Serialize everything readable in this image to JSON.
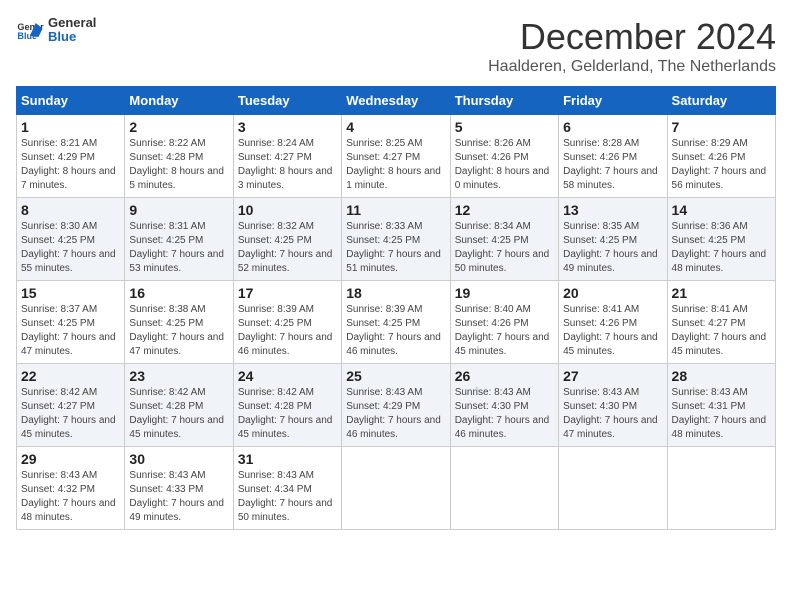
{
  "header": {
    "logo_general": "General",
    "logo_blue": "Blue",
    "month_title": "December 2024",
    "location": "Haalderen, Gelderland, The Netherlands"
  },
  "calendar": {
    "days_of_week": [
      "Sunday",
      "Monday",
      "Tuesday",
      "Wednesday",
      "Thursday",
      "Friday",
      "Saturday"
    ],
    "weeks": [
      [
        {
          "day": "1",
          "sunrise": "8:21 AM",
          "sunset": "4:29 PM",
          "daylight": "8 hours and 7 minutes."
        },
        {
          "day": "2",
          "sunrise": "8:22 AM",
          "sunset": "4:28 PM",
          "daylight": "8 hours and 5 minutes."
        },
        {
          "day": "3",
          "sunrise": "8:24 AM",
          "sunset": "4:27 PM",
          "daylight": "8 hours and 3 minutes."
        },
        {
          "day": "4",
          "sunrise": "8:25 AM",
          "sunset": "4:27 PM",
          "daylight": "8 hours and 1 minute."
        },
        {
          "day": "5",
          "sunrise": "8:26 AM",
          "sunset": "4:26 PM",
          "daylight": "8 hours and 0 minutes."
        },
        {
          "day": "6",
          "sunrise": "8:28 AM",
          "sunset": "4:26 PM",
          "daylight": "7 hours and 58 minutes."
        },
        {
          "day": "7",
          "sunrise": "8:29 AM",
          "sunset": "4:26 PM",
          "daylight": "7 hours and 56 minutes."
        }
      ],
      [
        {
          "day": "8",
          "sunrise": "8:30 AM",
          "sunset": "4:25 PM",
          "daylight": "7 hours and 55 minutes."
        },
        {
          "day": "9",
          "sunrise": "8:31 AM",
          "sunset": "4:25 PM",
          "daylight": "7 hours and 53 minutes."
        },
        {
          "day": "10",
          "sunrise": "8:32 AM",
          "sunset": "4:25 PM",
          "daylight": "7 hours and 52 minutes."
        },
        {
          "day": "11",
          "sunrise": "8:33 AM",
          "sunset": "4:25 PM",
          "daylight": "7 hours and 51 minutes."
        },
        {
          "day": "12",
          "sunrise": "8:34 AM",
          "sunset": "4:25 PM",
          "daylight": "7 hours and 50 minutes."
        },
        {
          "day": "13",
          "sunrise": "8:35 AM",
          "sunset": "4:25 PM",
          "daylight": "7 hours and 49 minutes."
        },
        {
          "day": "14",
          "sunrise": "8:36 AM",
          "sunset": "4:25 PM",
          "daylight": "7 hours and 48 minutes."
        }
      ],
      [
        {
          "day": "15",
          "sunrise": "8:37 AM",
          "sunset": "4:25 PM",
          "daylight": "7 hours and 47 minutes."
        },
        {
          "day": "16",
          "sunrise": "8:38 AM",
          "sunset": "4:25 PM",
          "daylight": "7 hours and 47 minutes."
        },
        {
          "day": "17",
          "sunrise": "8:39 AM",
          "sunset": "4:25 PM",
          "daylight": "7 hours and 46 minutes."
        },
        {
          "day": "18",
          "sunrise": "8:39 AM",
          "sunset": "4:25 PM",
          "daylight": "7 hours and 46 minutes."
        },
        {
          "day": "19",
          "sunrise": "8:40 AM",
          "sunset": "4:26 PM",
          "daylight": "7 hours and 45 minutes."
        },
        {
          "day": "20",
          "sunrise": "8:41 AM",
          "sunset": "4:26 PM",
          "daylight": "7 hours and 45 minutes."
        },
        {
          "day": "21",
          "sunrise": "8:41 AM",
          "sunset": "4:27 PM",
          "daylight": "7 hours and 45 minutes."
        }
      ],
      [
        {
          "day": "22",
          "sunrise": "8:42 AM",
          "sunset": "4:27 PM",
          "daylight": "7 hours and 45 minutes."
        },
        {
          "day": "23",
          "sunrise": "8:42 AM",
          "sunset": "4:28 PM",
          "daylight": "7 hours and 45 minutes."
        },
        {
          "day": "24",
          "sunrise": "8:42 AM",
          "sunset": "4:28 PM",
          "daylight": "7 hours and 45 minutes."
        },
        {
          "day": "25",
          "sunrise": "8:43 AM",
          "sunset": "4:29 PM",
          "daylight": "7 hours and 46 minutes."
        },
        {
          "day": "26",
          "sunrise": "8:43 AM",
          "sunset": "4:30 PM",
          "daylight": "7 hours and 46 minutes."
        },
        {
          "day": "27",
          "sunrise": "8:43 AM",
          "sunset": "4:30 PM",
          "daylight": "7 hours and 47 minutes."
        },
        {
          "day": "28",
          "sunrise": "8:43 AM",
          "sunset": "4:31 PM",
          "daylight": "7 hours and 48 minutes."
        }
      ],
      [
        {
          "day": "29",
          "sunrise": "8:43 AM",
          "sunset": "4:32 PM",
          "daylight": "7 hours and 48 minutes."
        },
        {
          "day": "30",
          "sunrise": "8:43 AM",
          "sunset": "4:33 PM",
          "daylight": "7 hours and 49 minutes."
        },
        {
          "day": "31",
          "sunrise": "8:43 AM",
          "sunset": "4:34 PM",
          "daylight": "7 hours and 50 minutes."
        },
        null,
        null,
        null,
        null
      ]
    ]
  }
}
